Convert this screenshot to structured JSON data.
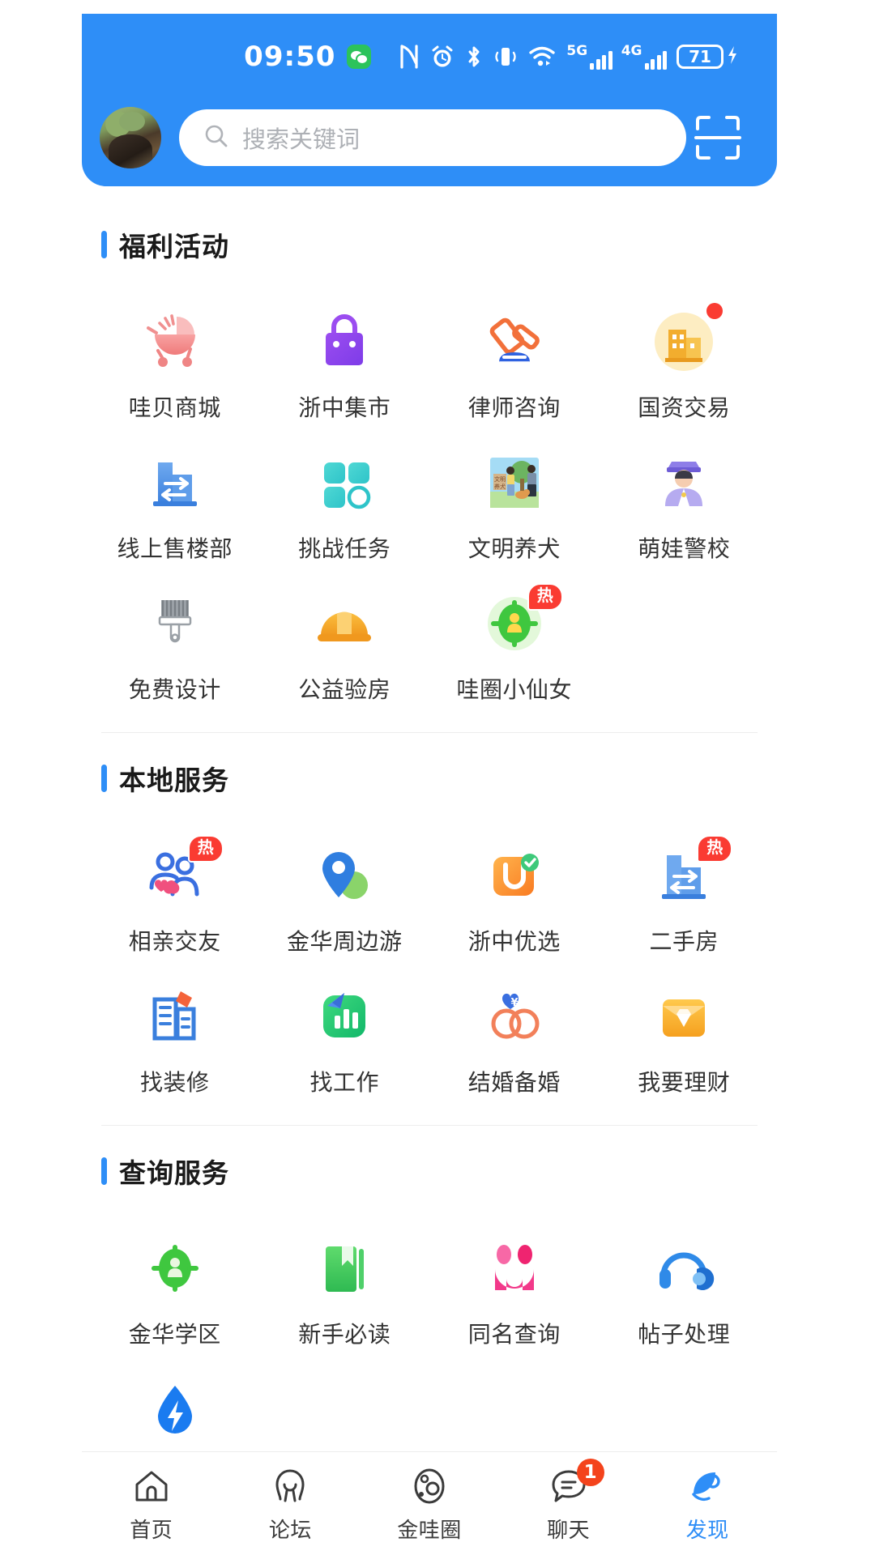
{
  "status_bar": {
    "time": "09:50",
    "wechat_icon": "wechat-icon",
    "nfc_icon": "nfc-icon",
    "alarm_icon": "alarm-icon",
    "bluetooth_icon": "bluetooth-icon",
    "vibrate_icon": "vibrate-icon",
    "wifi_icon": "wifi-icon",
    "net5g_label": "5G",
    "net4g_label": "4G",
    "battery_level": "71",
    "charging_icon": "lightning-bolt-icon"
  },
  "header": {
    "avatar": "user-avatar",
    "search_placeholder": "搜索关键词",
    "search_icon": "search-icon",
    "scan_icon": "scan-qr-icon",
    "accent_color": "#2e8ef7"
  },
  "sections": [
    {
      "title": "福利活动",
      "items": [
        {
          "label": "哇贝商城",
          "icon": "stroller-icon",
          "badge": ""
        },
        {
          "label": "浙中集市",
          "icon": "shopping-bag-icon",
          "badge": ""
        },
        {
          "label": "律师咨询",
          "icon": "gavel-icon",
          "badge": ""
        },
        {
          "label": "国资交易",
          "icon": "building-coin-icon",
          "badge": "dot"
        },
        {
          "label": "线上售楼部",
          "icon": "building-swap-icon",
          "badge": ""
        },
        {
          "label": "挑战任务",
          "icon": "four-grid-icon",
          "badge": ""
        },
        {
          "label": "文明养犬",
          "icon": "dog-walk-photo-icon",
          "badge": ""
        },
        {
          "label": "萌娃警校",
          "icon": "police-kid-icon",
          "badge": ""
        },
        {
          "label": "免费设计",
          "icon": "paintbrush-icon",
          "badge": ""
        },
        {
          "label": "公益验房",
          "icon": "hardhat-icon",
          "badge": ""
        },
        {
          "label": "哇圈小仙女",
          "icon": "green-person-icon",
          "badge": "热"
        }
      ]
    },
    {
      "title": "本地服务",
      "items": [
        {
          "label": "相亲交友",
          "icon": "couple-heart-icon",
          "badge": "热"
        },
        {
          "label": "金华周边游",
          "icon": "map-pin-icon",
          "badge": ""
        },
        {
          "label": "浙中优选",
          "icon": "orange-bag-check-icon",
          "badge": ""
        },
        {
          "label": "二手房",
          "icon": "building-swap-icon",
          "badge": "热"
        },
        {
          "label": "找装修",
          "icon": "renovation-icon",
          "badge": ""
        },
        {
          "label": "找工作",
          "icon": "green-chart-icon",
          "badge": ""
        },
        {
          "label": "结婚备婚",
          "icon": "wedding-rings-icon",
          "badge": ""
        },
        {
          "label": "我要理财",
          "icon": "wallet-diamond-icon",
          "badge": ""
        }
      ]
    },
    {
      "title": "查询服务",
      "items": [
        {
          "label": "金华学区",
          "icon": "green-person-icon",
          "badge": ""
        },
        {
          "label": "新手必读",
          "icon": "green-book-icon",
          "badge": ""
        },
        {
          "label": "同名查询",
          "icon": "pink-face-icon",
          "badge": ""
        },
        {
          "label": "帖子处理",
          "icon": "headset-icon",
          "badge": ""
        },
        {
          "label": "",
          "icon": "blue-drop-bolt-icon",
          "badge": ""
        }
      ]
    }
  ],
  "tabbar": {
    "tabs": [
      {
        "label": "首页",
        "icon": "home-icon",
        "badge": "",
        "active": false
      },
      {
        "label": "论坛",
        "icon": "forum-icon",
        "badge": "",
        "active": false
      },
      {
        "label": "金哇圈",
        "icon": "circle-orbit-icon",
        "badge": "",
        "active": false
      },
      {
        "label": "聊天",
        "icon": "chat-bubble-icon",
        "badge": "1",
        "active": false
      },
      {
        "label": "发现",
        "icon": "discover-icon",
        "badge": "",
        "active": true
      }
    ],
    "active_color": "#2e8ef7"
  }
}
